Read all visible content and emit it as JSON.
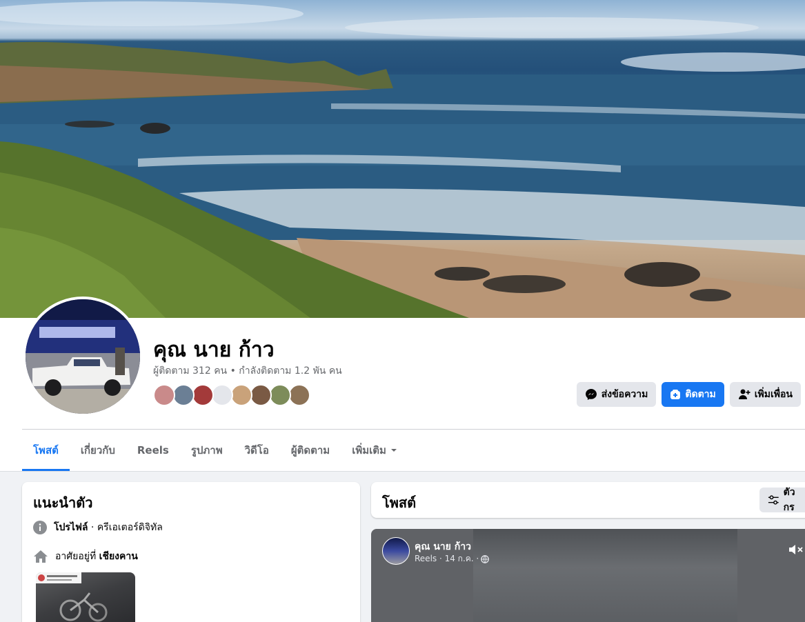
{
  "profile": {
    "name": "คุณ นาย ก้าว",
    "followers_line": "ผู้ติดตาม 312 คน • กำลังติดตาม 1.2 พัน คน"
  },
  "friend_avatar_colors": [
    "#c98a8a",
    "#6b7f95",
    "#a33a3a",
    "#e4e6eb",
    "#c9a27a",
    "#7a5a44",
    "#7d8c5a",
    "#8c7256"
  ],
  "actions": {
    "message_label": "ส่งข้อความ",
    "follow_label": "ติดตาม",
    "add_friend_label": "เพิ่มเพื่อน"
  },
  "tabs": {
    "posts": "โพสต์",
    "about": "เกี่ยวกับ",
    "reels": "Reels",
    "photos": "รูปภาพ",
    "videos": "วิดีโอ",
    "followers": "ผู้ติดตาม",
    "more": "เพิ่มเติม"
  },
  "intro": {
    "title": "แนะนำตัว",
    "profile_label": "โปรไฟล์",
    "profile_type": " · ครีเอเตอร์ดิจิทัล",
    "lives_in_prefix": "อาศัยอยู่ที่",
    "lives_in_place": "เชียงคาน"
  },
  "posts": {
    "title": "โพสต์",
    "filter_label": "ตัวกร"
  },
  "reel_post": {
    "author": "คุณ นาย ก้าว",
    "meta": "Reels · 14 ก.ค. ·"
  },
  "colors": {
    "accent": "#1877f2",
    "secondary_button": "#e4e6eb",
    "text_secondary": "#65676b"
  }
}
